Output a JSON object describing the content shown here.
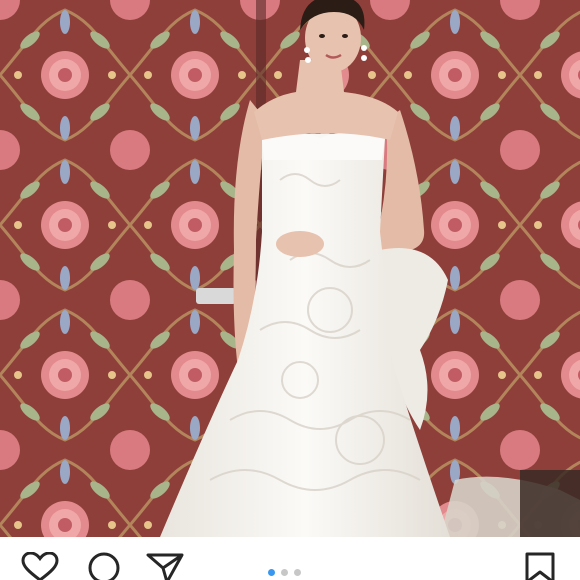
{
  "post": {
    "photo": {
      "subject": "bride-in-strapless-lace-mermaid-gown",
      "background": "floral-wallpaper",
      "colors": {
        "wallpaper_base": "#8e3f3a",
        "wallpaper_flower": "#e28a8d",
        "wallpaper_leaf": "#a8b58a",
        "gown": "#f5f3ef",
        "skin": "#e7c2ae",
        "hair": "#2b1c16"
      }
    },
    "actions": [
      {
        "icon": "heart-icon"
      },
      {
        "icon": "comment-icon"
      },
      {
        "icon": "share-icon"
      },
      {
        "icon": "bookmark-icon"
      }
    ],
    "carousel": {
      "total": 3,
      "active_index": 1,
      "active_color": "#3897f0",
      "inactive_color": "#c7c7c7"
    }
  }
}
